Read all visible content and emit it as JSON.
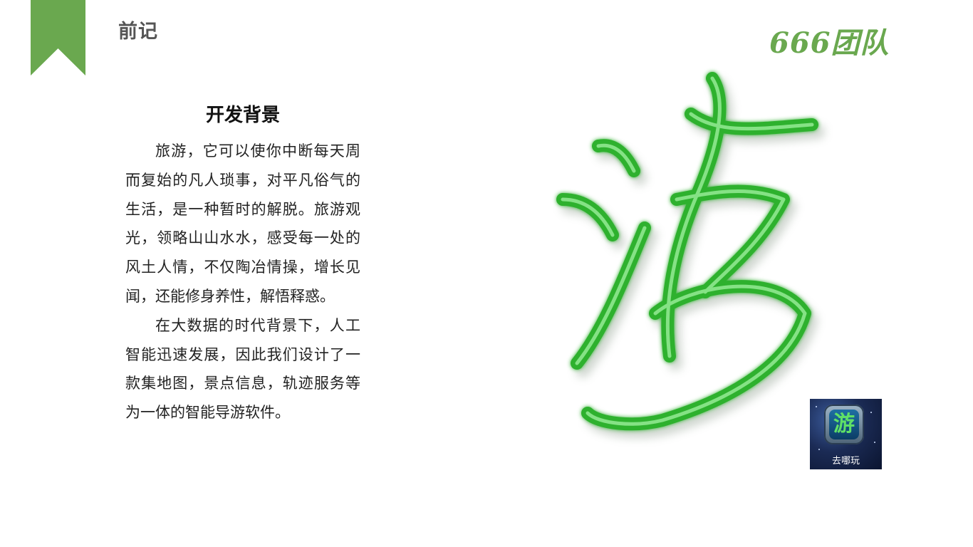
{
  "section_title": "前记",
  "team_logo": "666团队",
  "content": {
    "heading": "开发背景",
    "paragraphs": [
      "旅游，它可以使你中断每天周而复始的凡人琐事，对平凡俗气的生活，是一种暂时的解脱。旅游观光，领略山山水水，感受每一处的风土人情，不仅陶冶情操，增长见闻，还能修身养性，解悟释惑。",
      "在大数据的时代背景下，人工智能迅速发展，因此我们设计了一款集地图，景点信息，轨迹服务等为一体的智能导游软件。"
    ]
  },
  "graphic": {
    "character": "游",
    "color": "#3cc23c"
  },
  "app_icon": {
    "glyph": "游",
    "label": "去哪玩"
  },
  "colors": {
    "accent": "#6aa84f",
    "title_gray": "#555555"
  }
}
